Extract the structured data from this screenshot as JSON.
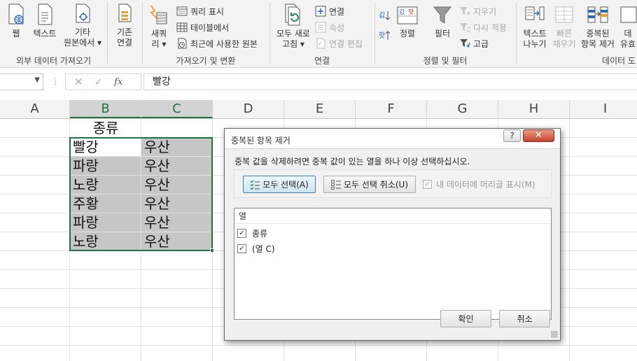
{
  "ribbon": {
    "get_external": {
      "label": "외부 데이터 가져오기",
      "web": "웹",
      "text": "텍스트",
      "other_1": "기타",
      "other_2": "원본에서 ▾",
      "existing_1": "기존",
      "existing_2": "연결"
    },
    "get_transform": {
      "label": "가져오기 및 변환",
      "new_query_1": "새쿼",
      "new_query_2": "리 ▾",
      "show_queries": "쿼리 표시",
      "from_table": "테이블에서",
      "recent_sources": "최근에 사용한 원본"
    },
    "connections": {
      "label": "연결",
      "refresh_all_1": "모두 새로",
      "refresh_all_2": "고침 ▾",
      "connections": "연결",
      "properties": "속성",
      "edit_links": "연결 편집"
    },
    "sort_filter": {
      "label": "정렬 및 필터",
      "sort": "정렬",
      "filter": "필터",
      "clear": "지우기",
      "reapply": "다시 적용",
      "advanced": "고급"
    },
    "data_tools": {
      "label": "데이터 도",
      "text_to_columns_1": "텍스트",
      "text_to_columns_2": "나누기",
      "flash_fill_1": "빠른",
      "flash_fill_2": "채우기",
      "remove_dup_1": "중복된",
      "remove_dup_2": "항목 제거",
      "validation_1": "데",
      "validation_2": "유효"
    }
  },
  "formula_bar": {
    "name_box": "",
    "cancel": "✕",
    "enter": "✓",
    "fx": "fx",
    "value": "빨강"
  },
  "grid": {
    "columns": [
      "A",
      "B",
      "C",
      "D",
      "E",
      "F",
      "G",
      "H",
      "I"
    ],
    "header_cell": "종류",
    "rows": [
      [
        "빨강",
        "우산"
      ],
      [
        "파랑",
        "우산"
      ],
      [
        "노랑",
        "우산"
      ],
      [
        "주황",
        "우산"
      ],
      [
        "파랑",
        "우산"
      ],
      [
        "노랑",
        "우산"
      ]
    ]
  },
  "dialog": {
    "title": "중복된 항목 제거",
    "help": "?",
    "close": "✕",
    "message": "중복 값을 삭제하려면 중복 값이 있는 열을 하나 이상 선택하십시오.",
    "select_all": "모두 선택(A)",
    "unselect_all": "모두 선택 취소(U)",
    "has_headers": "내 데이터에 머리글 표시(M)",
    "list_header": "열",
    "columns": [
      {
        "label": "종류",
        "checked": true
      },
      {
        "label": "(열 C)",
        "checked": true
      }
    ],
    "ok": "확인",
    "cancel": "취소"
  },
  "colors": {
    "excel_green": "#217346",
    "selection_fill": "#c6c6c6",
    "ribbon_bg": "#f3f3f3"
  }
}
